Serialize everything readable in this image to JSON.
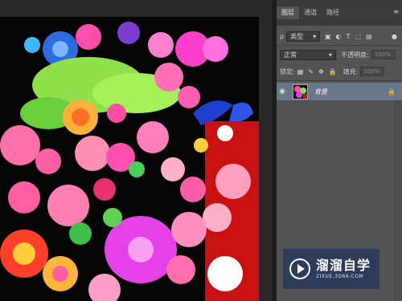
{
  "panel": {
    "tabs": [
      {
        "label": "图层",
        "active": true
      },
      {
        "label": "通道",
        "active": false
      },
      {
        "label": "路径",
        "active": false
      }
    ],
    "menu_icon": "panel-menu-icon",
    "filter": {
      "kind": "类型"
    },
    "blend_mode": "正常",
    "opacity_label": "不透明度:",
    "opacity_value": "100%",
    "lock_label": "锁定:",
    "fill_label": "填充:",
    "fill_value": "100%",
    "layer": {
      "name": "背景",
      "visible": true,
      "locked": true
    }
  },
  "watermark": {
    "title": "溜溜自学",
    "url": "ZIXUE.3D66.COM"
  },
  "colors": {
    "panel_bg": "#535353",
    "selected_layer": "#6a768a",
    "canvas_bg": "#282828",
    "watermark_bg": "#28375a"
  }
}
